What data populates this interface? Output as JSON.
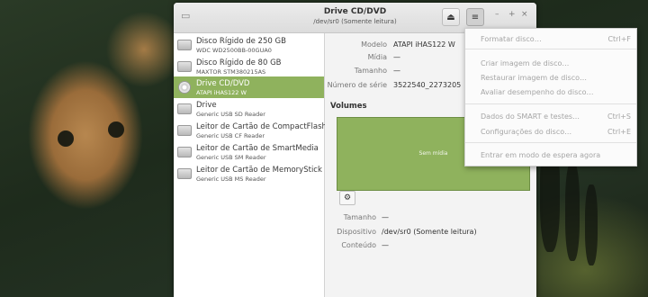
{
  "window": {
    "title": "Drive CD/DVD",
    "subtitle": "/dev/sr0 (Somente leitura)",
    "controls": [
      "–",
      "+",
      "×"
    ]
  },
  "drives": [
    {
      "name": "Disco Rígido de 250 GB",
      "model": "WDC WD2500BB-00GUA0",
      "icon": "hard-disk-icon",
      "selected": false
    },
    {
      "name": "Disco Rígido de 80 GB",
      "model": "MAXTOR STM380215AS",
      "icon": "hard-disk-icon",
      "selected": false
    },
    {
      "name": "Drive CD/DVD",
      "model": "ATAPI   iHAS122   W",
      "icon": "optical-disc-icon",
      "selected": true
    },
    {
      "name": "Drive",
      "model": "Generic USB SD Reader",
      "icon": "card-reader-icon",
      "selected": false
    },
    {
      "name": "Leitor de Cartão de CompactFlash",
      "model": "Generic USB CF Reader",
      "icon": "card-reader-icon",
      "selected": false
    },
    {
      "name": "Leitor de Cartão de SmartMedia",
      "model": "Generic USB SM Reader",
      "icon": "card-reader-icon",
      "selected": false
    },
    {
      "name": "Leitor de Cartão de MemoryStick",
      "model": "Generic USB MS Reader",
      "icon": "card-reader-icon",
      "selected": false
    }
  ],
  "details": {
    "model_label": "Modelo",
    "model_value": "ATAPI   iHAS122   W",
    "media_label": "Mídia",
    "media_value": "—",
    "size_label": "Tamanho",
    "size_value": "—",
    "serial_label": "Número de série",
    "serial_value": "3522540_2273205"
  },
  "volumes": {
    "header": "Volumes",
    "no_media": "Sem mídia",
    "size_label": "Tamanho",
    "size_value": "—",
    "device_label": "Dispositivo",
    "device_value": "/dev/sr0 (Somente leitura)",
    "content_label": "Conteúdo",
    "content_value": "—"
  },
  "menu": {
    "items": [
      {
        "label": "Formatar disco…",
        "shortcut": "Ctrl+F"
      },
      {
        "label": "Criar imagem de disco…",
        "shortcut": ""
      },
      {
        "label": "Restaurar imagem de disco…",
        "shortcut": ""
      },
      {
        "label": "Avaliar desempenho do disco…",
        "shortcut": ""
      },
      {
        "label": "Dados do SMART e testes…",
        "shortcut": "Ctrl+S"
      },
      {
        "label": "Configurações do disco…",
        "shortcut": "Ctrl+E"
      },
      {
        "label": "Entrar em modo de espera agora",
        "shortcut": ""
      }
    ]
  },
  "icons": {
    "eject": "eject-icon",
    "menu": "hamburger-menu-icon",
    "new_disk": "new-disk-image-icon",
    "volume_tools": "gear-icon"
  },
  "colors": {
    "selection": "#8fb25d",
    "volume_fill": "#8fb25d"
  }
}
